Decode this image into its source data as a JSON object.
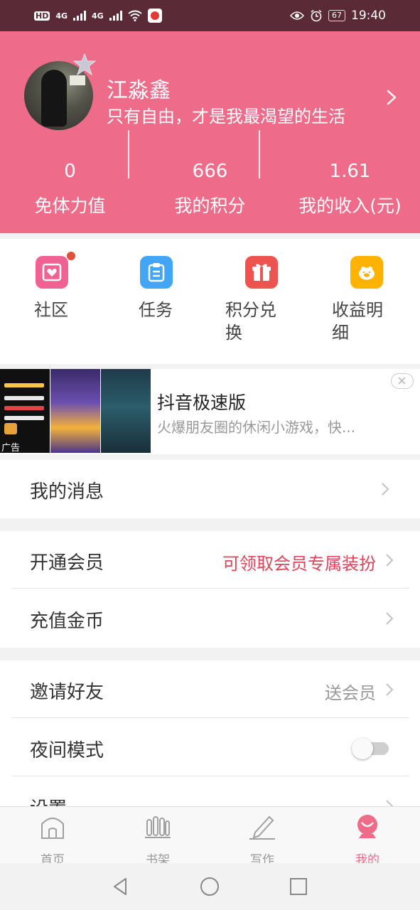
{
  "status_bar": {
    "hd_label": "HD",
    "signal1_label": "4G",
    "signal2_label": "4G",
    "battery": "67",
    "time": "19:40"
  },
  "profile": {
    "nickname": "江淼鑫",
    "signature": "只有自由，才是我最渴望的生活",
    "stats": [
      {
        "value": "0",
        "label": "免体力值"
      },
      {
        "value": "666",
        "label": "我的积分"
      },
      {
        "value": "1.61",
        "label": "我的收入(元)"
      }
    ]
  },
  "quick_actions": [
    {
      "label": "社区",
      "icon": "community-heart-icon",
      "color": "#f06292",
      "has_badge": true
    },
    {
      "label": "任务",
      "icon": "task-clipboard-icon",
      "color": "#42a5f5"
    },
    {
      "label": "积分兑\n换",
      "icon": "gift-icon",
      "color": "#ef5350"
    },
    {
      "label": "收益明\n细",
      "icon": "piggy-bank-icon",
      "color": "#ffb300"
    }
  ],
  "ad": {
    "tag": "广告",
    "title": "抖音极速版",
    "description": "火爆朋友圈的休闲小游戏，快..."
  },
  "menu": {
    "messages": {
      "label": "我的消息"
    },
    "vip": {
      "label": "开通会员",
      "hint": "可领取会员专属装扮",
      "hint_color": "#e0445a"
    },
    "recharge": {
      "label": "充值金币"
    },
    "invite": {
      "label": "邀请好友",
      "hint": "送会员",
      "hint_color": "#999999"
    },
    "night_mode": {
      "label": "夜间模式",
      "enabled": false
    },
    "settings": {
      "label": "设置"
    }
  },
  "tabbar": [
    {
      "label": "首页",
      "icon": "home-icon",
      "active": false
    },
    {
      "label": "书架",
      "icon": "bookshelf-icon",
      "active": false
    },
    {
      "label": "写作",
      "icon": "pen-write-icon",
      "active": false
    },
    {
      "label": "我的",
      "icon": "profile-smile-icon",
      "active": true
    }
  ],
  "colors": {
    "accent": "#ee6c8a",
    "status_bar": "#5a2a36"
  }
}
